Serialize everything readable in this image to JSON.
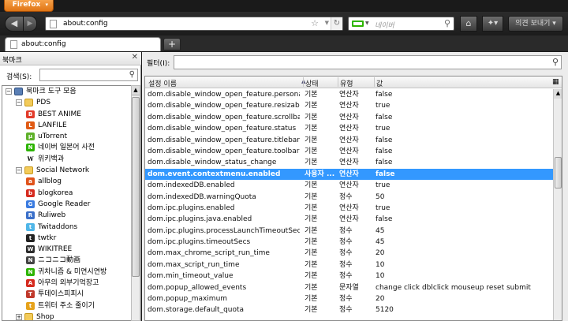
{
  "app_menu": {
    "label": "Firefox"
  },
  "navbar": {
    "url": "about:config",
    "search_placeholder": "네이버",
    "send_label": "의견 보내기"
  },
  "tabs": [
    {
      "title": "about:config"
    }
  ],
  "sidebar": {
    "title": "북마크",
    "search_label": "검색(S):",
    "tree": [
      {
        "label": "북마크 도구 모음",
        "depth": 0,
        "kind": "toolbar",
        "expanded": true
      },
      {
        "label": "PDS",
        "depth": 1,
        "kind": "folder",
        "expanded": true
      },
      {
        "label": "BEST ANIME",
        "depth": 2,
        "kind": "bookmark",
        "color": "#e23b2a",
        "glyph": "B"
      },
      {
        "label": "LANFILE",
        "depth": 2,
        "kind": "bookmark",
        "color": "#e05a14",
        "glyph": "L"
      },
      {
        "label": "uTorrent",
        "depth": 2,
        "kind": "bookmark",
        "color": "#5fb12a",
        "glyph": "µ"
      },
      {
        "label": "네이버 일본어 사전",
        "depth": 2,
        "kind": "bookmark",
        "color": "#2db400",
        "glyph": "N"
      },
      {
        "label": "위키백과",
        "depth": 2,
        "kind": "bookmark",
        "color": "#ffffff",
        "glyph": "W"
      },
      {
        "label": "Social Network",
        "depth": 1,
        "kind": "folder",
        "expanded": true
      },
      {
        "label": "allblog",
        "depth": 2,
        "kind": "bookmark",
        "color": "#e0531b",
        "glyph": "a"
      },
      {
        "label": "blogkorea",
        "depth": 2,
        "kind": "bookmark",
        "color": "#d62b1f",
        "glyph": "b"
      },
      {
        "label": "Google Reader",
        "depth": 2,
        "kind": "bookmark",
        "color": "#3a7be0",
        "glyph": "G"
      },
      {
        "label": "Ruliweb",
        "depth": 2,
        "kind": "bookmark",
        "color": "#3a6fc9",
        "glyph": "R"
      },
      {
        "label": "Twitaddons",
        "depth": 2,
        "kind": "bookmark",
        "color": "#4fb6e8",
        "glyph": "t"
      },
      {
        "label": "twtkr",
        "depth": 2,
        "kind": "bookmark",
        "color": "#222222",
        "glyph": "t"
      },
      {
        "label": "WIKITREE",
        "depth": 2,
        "kind": "bookmark",
        "color": "#2c2c2c",
        "glyph": "W"
      },
      {
        "label": "ニコニコ動画",
        "depth": 2,
        "kind": "bookmark",
        "color": "#444444",
        "glyph": "N"
      },
      {
        "label": "귀차니즘 & 미연시연방",
        "depth": 2,
        "kind": "bookmark",
        "color": "#2db400",
        "glyph": "N"
      },
      {
        "label": "아무의 외부기억장고",
        "depth": 2,
        "kind": "bookmark",
        "color": "#d62b1f",
        "glyph": "A"
      },
      {
        "label": "투데이스피피시",
        "depth": 2,
        "kind": "bookmark",
        "color": "#c0392b",
        "glyph": "T"
      },
      {
        "label": "트위터 주소 줄이기",
        "depth": 2,
        "kind": "bookmark",
        "color": "#e6a21a",
        "glyph": "t"
      },
      {
        "label": "Shop",
        "depth": 1,
        "kind": "folder",
        "expanded": false
      }
    ]
  },
  "config": {
    "filter_label": "필터(I):",
    "columns": [
      "설정 이름",
      "상태",
      "유형",
      "값"
    ],
    "selected_row": 8,
    "rows": [
      [
        "dom.disable_window_open_feature.persona...",
        "기본",
        "연산자",
        "false"
      ],
      [
        "dom.disable_window_open_feature.resizable",
        "기본",
        "연산자",
        "true"
      ],
      [
        "dom.disable_window_open_feature.scrollbars",
        "기본",
        "연산자",
        "false"
      ],
      [
        "dom.disable_window_open_feature.status",
        "기본",
        "연산자",
        "true"
      ],
      [
        "dom.disable_window_open_feature.titlebar",
        "기본",
        "연산자",
        "false"
      ],
      [
        "dom.disable_window_open_feature.toolbar",
        "기본",
        "연산자",
        "false"
      ],
      [
        "dom.disable_window_status_change",
        "기본",
        "연산자",
        "false"
      ],
      [
        "dom.event.contextmenu.enabled",
        "사용자 ...",
        "연산자",
        "false"
      ],
      [
        "dom.indexedDB.enabled",
        "기본",
        "연산자",
        "true"
      ],
      [
        "dom.indexedDB.warningQuota",
        "기본",
        "정수",
        "50"
      ],
      [
        "dom.ipc.plugins.enabled",
        "기본",
        "연산자",
        "true"
      ],
      [
        "dom.ipc.plugins.java.enabled",
        "기본",
        "연산자",
        "false"
      ],
      [
        "dom.ipc.plugins.processLaunchTimeoutSecs",
        "기본",
        "정수",
        "45"
      ],
      [
        "dom.ipc.plugins.timeoutSecs",
        "기본",
        "정수",
        "45"
      ],
      [
        "dom.max_chrome_script_run_time",
        "기본",
        "정수",
        "20"
      ],
      [
        "dom.max_script_run_time",
        "기본",
        "정수",
        "10"
      ],
      [
        "dom.min_timeout_value",
        "기본",
        "정수",
        "10"
      ],
      [
        "dom.popup_allowed_events",
        "기본",
        "문자열",
        "change click dblclick mouseup reset submit"
      ],
      [
        "dom.popup_maximum",
        "기본",
        "정수",
        "20"
      ],
      [
        "dom.storage.default_quota",
        "기본",
        "정수",
        "5120"
      ]
    ]
  }
}
